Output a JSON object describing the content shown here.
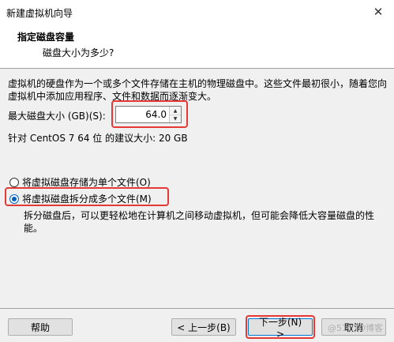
{
  "window": {
    "title": "新建虚拟机向导"
  },
  "header": {
    "title": "指定磁盘容量",
    "subtitle": "磁盘大小为多少?"
  },
  "description": "虚拟机的硬盘作为一个或多个文件存储在主机的物理磁盘中。这些文件最初很小，随着您向虚拟机中添加应用程序、文件和数据而逐渐变大。",
  "disk_size": {
    "label": "最大磁盘大小 (GB)(S):",
    "value": "64.0"
  },
  "recommended": "针对 CentOS 7 64 位 的建议大小: 20 GB",
  "options": {
    "single_file": {
      "label": "将虚拟磁盘存储为单个文件(O)",
      "checked": false
    },
    "split_files": {
      "label": "将虚拟磁盘拆分成多个文件(M)",
      "checked": true
    }
  },
  "split_description": "拆分磁盘后，可以更轻松地在计算机之间移动虚拟机，但可能会降低大容量磁盘的性能。",
  "buttons": {
    "help": "帮助",
    "back": "< 上一步(B)",
    "next": "下一步(N) >",
    "cancel": "取消"
  },
  "watermark": "@51CTO博客",
  "colors": {
    "highlight": "#e53935",
    "accent": "#0060c0"
  },
  "icons": {
    "close": "close-icon",
    "spin_up": "triangle-up-icon",
    "spin_down": "triangle-down-icon"
  }
}
